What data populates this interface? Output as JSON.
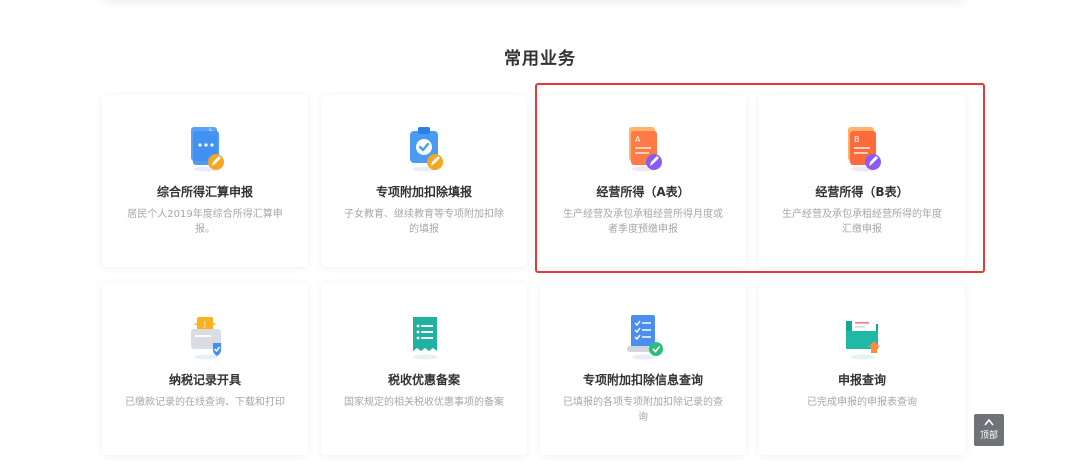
{
  "section": {
    "title": "常用业务"
  },
  "cards": [
    {
      "title": "综合所得汇算申报",
      "desc": "居民个人2019年度综合所得汇算申报。",
      "icon": "document-pencil-icon"
    },
    {
      "title": "专项附加扣除填报",
      "desc": "子女教育、继续教育等专项附加扣除的填报",
      "icon": "clipboard-check-icon"
    },
    {
      "title": "经营所得（A表）",
      "desc": "生产经营及承包承租经营所得月度或者季度预缴申报",
      "icon": "form-a-icon"
    },
    {
      "title": "经营所得（B表）",
      "desc": "生产经营及承包承租经营所得的年度汇缴申报",
      "icon": "form-b-icon"
    },
    {
      "title": "纳税记录开具",
      "desc": "已缴款记录的在线查询、下载和打印",
      "icon": "tax-record-box-icon"
    },
    {
      "title": "税收优惠备案",
      "desc": "国家规定的相关税收优惠事项的备案",
      "icon": "receipt-list-icon"
    },
    {
      "title": "专项附加扣除信息查询",
      "desc": "已填报的各项专项附加扣除记录的查询",
      "icon": "scroll-check-icon"
    },
    {
      "title": "申报查询",
      "desc": "已完成申报的申报表查询",
      "icon": "folder-upload-icon"
    }
  ],
  "back_to_top": {
    "label": "顶部"
  },
  "colors": {
    "highlight": "#e53935",
    "title_text": "#333333",
    "desc_text": "#a7a7a7"
  }
}
